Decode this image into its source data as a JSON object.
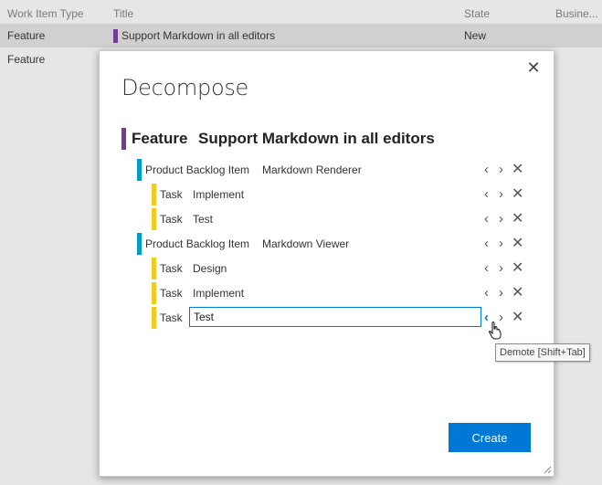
{
  "grid": {
    "columns": [
      "Work Item Type",
      "Title",
      "State",
      "Busine..."
    ],
    "rows": [
      {
        "type": "Feature",
        "title": "Support Markdown in all editors",
        "state": "New"
      },
      {
        "type": "Feature",
        "title": "",
        "state": ""
      }
    ]
  },
  "dialog": {
    "title": "Decompose",
    "close_glyph": "✕",
    "root": {
      "type": "Feature",
      "title": "Support Markdown in all editors"
    },
    "items": [
      {
        "type": "Product Backlog Item",
        "title": "Markdown Renderer"
      },
      {
        "type": "Task",
        "title": "Implement"
      },
      {
        "type": "Task",
        "title": "Test"
      },
      {
        "type": "Product Backlog Item",
        "title": "Markdown Viewer"
      },
      {
        "type": "Task",
        "title": "Design"
      },
      {
        "type": "Task",
        "title": "Implement"
      },
      {
        "type": "Task",
        "title": "Test"
      }
    ],
    "controls": {
      "demote": "‹",
      "promote": "›",
      "remove": "✕"
    },
    "tooltip": "Demote [Shift+Tab]",
    "create_label": "Create"
  },
  "colors": {
    "feature": "#773b93",
    "product_backlog_item": "#009ccc",
    "task": "#f2cb1d",
    "accent": "#0078d7"
  },
  "icons": [
    "close-icon",
    "chevron-left-icon",
    "chevron-right-icon",
    "remove-icon",
    "hand-cursor-icon",
    "resize-grip-icon"
  ]
}
